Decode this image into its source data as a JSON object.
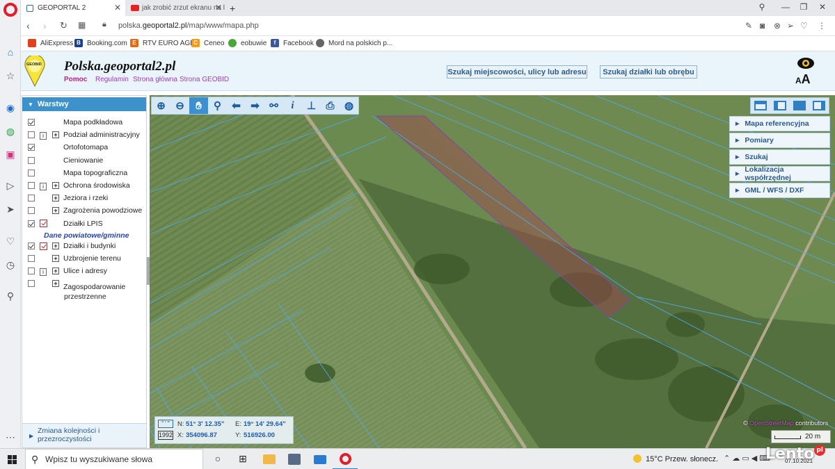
{
  "browser": {
    "tabs": [
      {
        "title": "GEOPORTAL 2",
        "active": true
      },
      {
        "title": "jak zrobić zrzut ekranu na l",
        "active": false
      }
    ],
    "new_tab_label": "+",
    "url_prefix": "polska.",
    "url_domain": "geoportal2.pl",
    "url_path": "/map/www/mapa.php",
    "bookmarks": [
      "AliExpress",
      "Booking.com",
      "RTV EURO AGD",
      "Ceneo",
      "eobuwie",
      "Facebook",
      "Mord na polskich p..."
    ]
  },
  "header": {
    "title": "Polska.geoportal2.pl",
    "logo_text": "GEOBID",
    "links": [
      "Pomoc",
      "Regulamin",
      "Strona główna",
      "Strona GEOBID"
    ],
    "search_address": "Szukaj miejscowości, ulicy lub adresu",
    "search_parcel": "Szukaj działki lub obrębu",
    "font_size_label": "A",
    "font_size_label_small": "A"
  },
  "layers_panel": {
    "title": "Warstwy",
    "layers": [
      {
        "label": "Mapa podkładowa",
        "checked": true,
        "info": false,
        "red": false,
        "plus": false
      },
      {
        "label": "Podział administracyjny",
        "checked": false,
        "info": true,
        "red": false,
        "plus": true
      },
      {
        "label": "Ortofotomapa",
        "checked": true,
        "info": false,
        "red": false,
        "plus": false
      },
      {
        "label": "Cieniowanie",
        "checked": false,
        "info": false,
        "red": false,
        "plus": false
      },
      {
        "label": "Mapa topograficzna",
        "checked": false,
        "info": false,
        "red": false,
        "plus": false
      },
      {
        "label": "Ochrona środowiska",
        "checked": false,
        "info": true,
        "red": false,
        "plus": true
      },
      {
        "label": "Jeziora i rzeki",
        "checked": false,
        "info": false,
        "red": false,
        "plus": true
      },
      {
        "label": "Zagrożenia powodziowe",
        "checked": false,
        "info": false,
        "red": false,
        "plus": true
      },
      {
        "label": "Działki LPIS",
        "checked": true,
        "info": false,
        "red": true,
        "plus": false
      }
    ],
    "group_label": "Dane powiatowe/gminne",
    "group_layers": [
      {
        "label": "Działki i budynki",
        "checked": true,
        "info": false,
        "red": true,
        "plus": true
      },
      {
        "label": "Uzbrojenie terenu",
        "checked": false,
        "info": false,
        "red": false,
        "plus": true
      },
      {
        "label": "Ulice i adresy",
        "checked": false,
        "info": true,
        "red": false,
        "plus": true
      },
      {
        "label": "Zagospodarowanie",
        "label2": "przestrzenne",
        "checked": false,
        "info": false,
        "red": false,
        "plus": true
      }
    ],
    "footer_line1": "Zmiana kolejności i",
    "footer_line2": "przezroczystości"
  },
  "map": {
    "tools": [
      "zoom-in-icon",
      "zoom-out-icon",
      "pan-hand-icon",
      "zoom-box-icon",
      "back-arrow-icon",
      "forward-arrow-icon",
      "link-icon",
      "info-icon",
      "measure-icon",
      "print-icon",
      "globe-icon"
    ],
    "side_menu": [
      "Mapa referencyjna",
      "Pomiary",
      "Szukaj",
      "Lokalizacja współrzędnej",
      "GML / WFS / DXF"
    ],
    "coords": {
      "crs": "1992",
      "n_label": "N:",
      "n_value": "51° 3' 12.35\"",
      "e_label": "E:",
      "e_value": "19° 14' 29.64\"",
      "x_label": "X:",
      "x_value": "354096.87",
      "y_label": "Y:",
      "y_value": "516926.00"
    },
    "attribution_osm": "OpenStreetMap",
    "attribution_rest": "contributors",
    "attribution_prefix": "©",
    "scale_label": "20 m",
    "highlight_color": "#b2463a"
  },
  "taskbar": {
    "search_placeholder": "Wpisz tu wyszukiwane słowa",
    "weather": "15°C  Przew. słonecz.",
    "date": "07.10.2021"
  },
  "watermark": {
    "text": "Lento",
    "suffix": "pl"
  }
}
